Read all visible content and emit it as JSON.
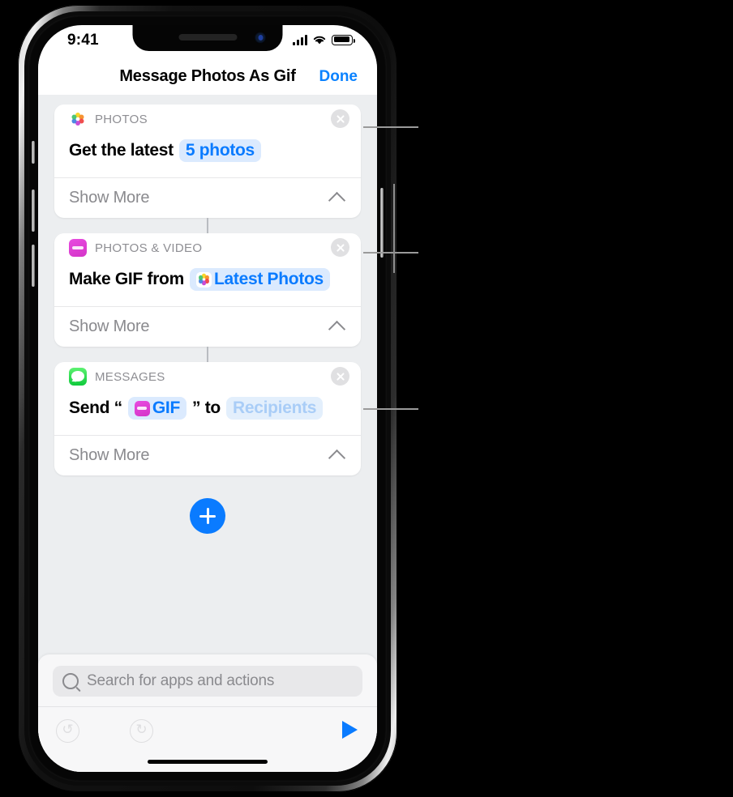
{
  "status_bar": {
    "time": "9:41",
    "cellular_icon": "signal-bars-icon",
    "wifi_icon": "wifi-icon",
    "battery_icon": "battery-icon"
  },
  "nav": {
    "title": "Message Photos As Gif",
    "done_label": "Done"
  },
  "colors": {
    "accent_blue": "#0a7bff",
    "token_bg": "#dbeafe",
    "token_muted_text": "#a9cdf7",
    "category_gray": "#8e8e93",
    "canvas": "#eceef0",
    "photos_magenta": "#d434c8",
    "messages_green": "#0ec93b"
  },
  "actions": [
    {
      "category": "PHOTOS",
      "icon": "photos-app-icon",
      "close_icon": "close-circle-icon",
      "text_before": "Get the latest",
      "token": {
        "label": "5 photos",
        "icon": null,
        "muted": false
      },
      "text_mid": "",
      "token2": null,
      "text_after": "",
      "show_more_label": "Show More",
      "chevron_icon": "chevron-up-icon"
    },
    {
      "category": "PHOTOS & VIDEO",
      "icon": "photos-video-app-icon",
      "close_icon": "close-circle-icon",
      "text_before": "Make GIF from",
      "token": {
        "label": "Latest Photos",
        "icon": "photos-app-icon",
        "muted": false
      },
      "text_mid": "",
      "token2": null,
      "text_after": "",
      "show_more_label": "Show More",
      "chevron_icon": "chevron-up-icon"
    },
    {
      "category": "MESSAGES",
      "icon": "messages-app-icon",
      "close_icon": "close-circle-icon",
      "text_before": "Send “",
      "token": {
        "label": "GIF",
        "icon": "photos-video-app-icon",
        "muted": false
      },
      "text_mid": "” to",
      "token2": {
        "label": "Recipients",
        "icon": null,
        "muted": true
      },
      "text_after": "",
      "show_more_label": "Show More",
      "chevron_icon": "chevron-up-icon"
    }
  ],
  "add_action": {
    "icon": "plus-icon",
    "label": "+"
  },
  "search": {
    "placeholder": "Search for apps and actions",
    "value": "",
    "icon": "search-icon"
  },
  "toolbar": {
    "undo_icon": "undo-arrow-icon",
    "redo_icon": "redo-arrow-icon",
    "undo_glyph": "↺",
    "redo_glyph": "↻",
    "play_icon": "play-triangle-icon"
  }
}
